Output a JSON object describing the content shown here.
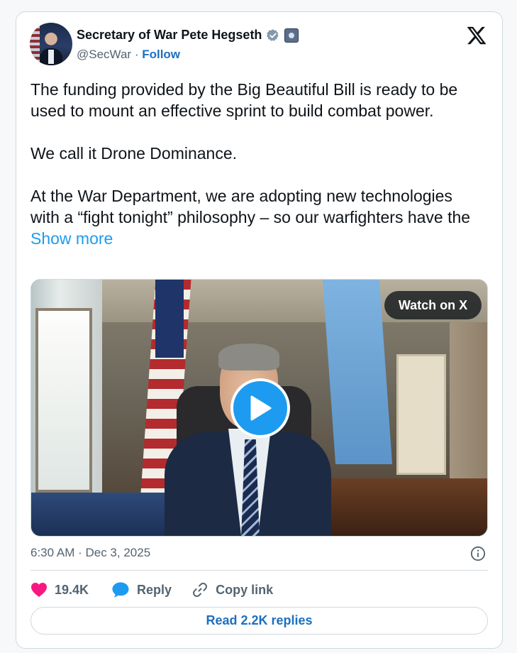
{
  "author": {
    "display_name": "Secretary of War Pete Hegseth",
    "handle": "@SecWar",
    "separator": " · ",
    "follow_label": "Follow",
    "verified_icon": "verified-badge-icon",
    "affiliation_icon": "dod-seal-icon"
  },
  "platform_logo": "x-logo-icon",
  "tweet": {
    "paragraph_1": "The funding provided by the Big Beautiful Bill is ready to be used to mount an effective sprint to build combat power.",
    "paragraph_2": "We call it Drone Dominance.",
    "paragraph_3": "At the War Department, we are adopting new technologies with a “fight tonight” philosophy – so our warfighters have the ",
    "show_more_label": "Show more"
  },
  "media": {
    "watch_label": "Watch on X",
    "play_icon": "play-icon"
  },
  "meta": {
    "timestamp": "6:30 AM · Dec 3, 2025",
    "info_icon": "info-icon"
  },
  "actions": {
    "likes_count": "19.4K",
    "reply_label": "Reply",
    "copy_link_label": "Copy link"
  },
  "read_replies_label": "Read 2.2K replies",
  "colors": {
    "accent": "#1d9bf0",
    "link": "#1d6fbf",
    "like": "#f91880",
    "muted": "#536471",
    "border": "#cfd9de"
  }
}
